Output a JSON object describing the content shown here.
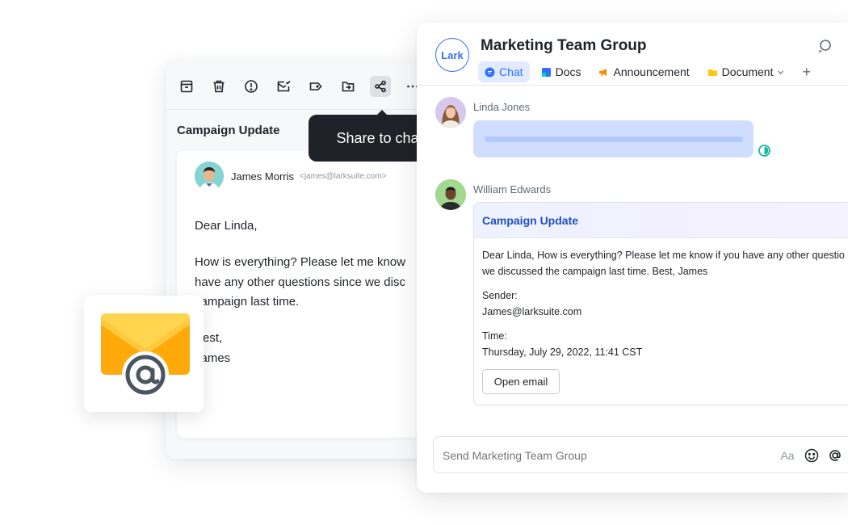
{
  "email": {
    "subject": "Campaign Update",
    "sender_name": "James Morris",
    "sender_email": "<james@larksuite.com>",
    "greeting": "Dear Linda,",
    "body_lines": [
      "How is everything? Please let me know",
      "have any other questions since we disc",
      "campaign last time.",
      "Best,",
      "James"
    ]
  },
  "tooltip": {
    "text": "Share to chat"
  },
  "chat": {
    "logo_text": "Lark",
    "group_title": "Marketing Team Group",
    "tabs": [
      {
        "label": "Chat"
      },
      {
        "label": "Docs"
      },
      {
        "label": "Announcement"
      },
      {
        "label": "Document"
      }
    ],
    "messages": {
      "first_sender": "Linda Jones",
      "second_sender": "William Edwards"
    },
    "email_card": {
      "title": "Campaign Update",
      "line1": "Dear Linda, How is everything? Please let me know if you have any other questio",
      "line2": "we discussed the campaign last time.  Best, James",
      "sender_label": "Sender:",
      "sender_value": "James@larksuite.com",
      "time_label": "Time:",
      "time_value": "Thursday, July 29, 2022, 11:41 CST",
      "open_button": "Open email"
    },
    "input": {
      "placeholder": "Send Marketing Team Group",
      "font_label": "Aa"
    }
  },
  "colors": {
    "accent": "#3370ff",
    "tooltip_bg": "#1f2329",
    "mail_yellow": "#ffc83d",
    "mail_orange": "#ffa90a",
    "read_green": "#14b8a6"
  }
}
